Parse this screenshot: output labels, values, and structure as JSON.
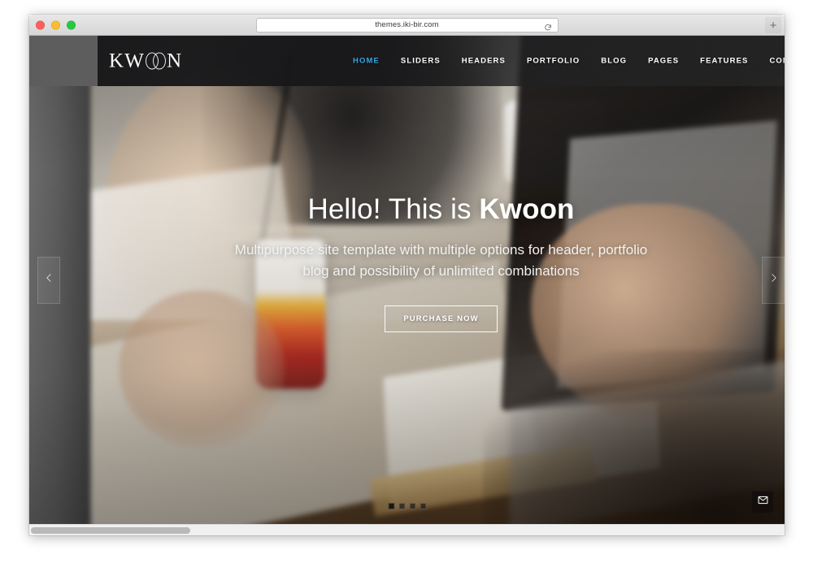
{
  "browser": {
    "url": "themes.iki-bir.com",
    "reload_icon": "reload-icon",
    "new_tab_label": "+",
    "traffic_lights": [
      "close",
      "minimize",
      "maximize"
    ]
  },
  "site": {
    "logo": {
      "prefix": "KW",
      "suffix": "N",
      "full": "KWOON"
    },
    "nav": [
      {
        "label": "HOME",
        "active": true
      },
      {
        "label": "SLIDERS",
        "active": false
      },
      {
        "label": "HEADERS",
        "active": false
      },
      {
        "label": "PORTFOLIO",
        "active": false
      },
      {
        "label": "BLOG",
        "active": false
      },
      {
        "label": "PAGES",
        "active": false
      },
      {
        "label": "FEATURES",
        "active": false
      },
      {
        "label": "CONTACT",
        "active": false
      }
    ],
    "accent_color": "#35a8e0",
    "header_bg": "#17171a"
  },
  "hero": {
    "title_light": "Hello! This is ",
    "title_bold": "Kwoon",
    "subtitle_line1": "Multipurpose site template with multiple options for header, portfolio",
    "subtitle_line2": "blog and possibility of unlimited combinations",
    "cta_label": "PURCHASE NOW",
    "prev_icon": "chevron-left-icon",
    "next_icon": "chevron-right-icon",
    "mail_icon": "envelope-icon",
    "slides": [
      {
        "active": true
      },
      {
        "active": false
      },
      {
        "active": false
      },
      {
        "active": false
      }
    ]
  }
}
